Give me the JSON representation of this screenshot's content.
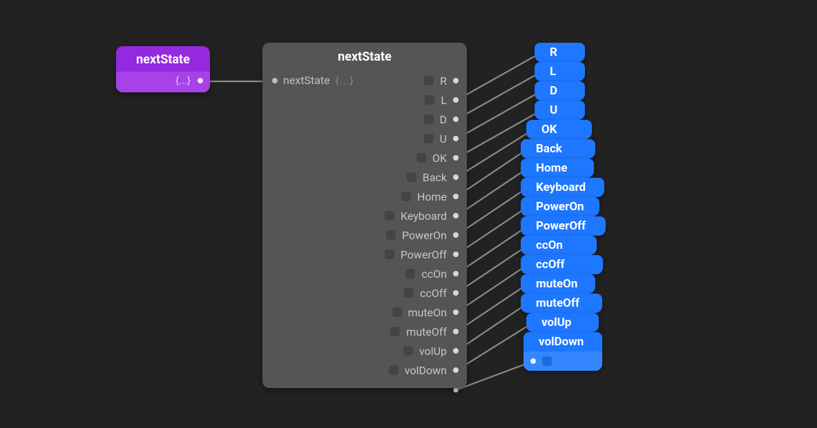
{
  "purple": {
    "title": "nextState",
    "output_braces": "{...}"
  },
  "grey": {
    "title": "nextState",
    "input_label": "nextState",
    "input_braces": "{...}",
    "props": [
      {
        "label": "R"
      },
      {
        "label": "L"
      },
      {
        "label": "D"
      },
      {
        "label": "U"
      },
      {
        "label": "OK"
      },
      {
        "label": "Back"
      },
      {
        "label": "Home"
      },
      {
        "label": "Keyboard"
      },
      {
        "label": "PowerOn"
      },
      {
        "label": "PowerOff"
      },
      {
        "label": "ccOn"
      },
      {
        "label": "ccOff"
      },
      {
        "label": "muteOn"
      },
      {
        "label": "muteOff"
      },
      {
        "label": "volUp"
      },
      {
        "label": "volDown"
      }
    ]
  },
  "blue_nodes": [
    {
      "title": "R"
    },
    {
      "title": "L"
    },
    {
      "title": "D"
    },
    {
      "title": "U"
    },
    {
      "title": "OK"
    },
    {
      "title": "Back"
    },
    {
      "title": "Home"
    },
    {
      "title": "Keyboard"
    },
    {
      "title": "PowerOn"
    },
    {
      "title": "PowerOff"
    },
    {
      "title": "ccOn"
    },
    {
      "title": "ccOff"
    },
    {
      "title": "muteOn"
    },
    {
      "title": "muteOff"
    },
    {
      "title": "volUp"
    },
    {
      "title": "volDown"
    }
  ],
  "colors": {
    "bg": "#222222",
    "purple": "#9429e0",
    "grey": "#555555",
    "blue": "#1e77ff",
    "wire": "#8c8c8c"
  }
}
